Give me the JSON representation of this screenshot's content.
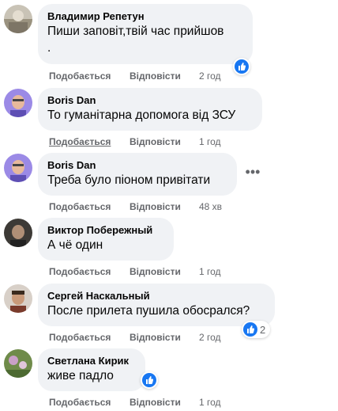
{
  "colors": {
    "accent": "#1877f2",
    "bubble": "#f0f2f5",
    "meta": "#65676b"
  },
  "labels": {
    "like": "Подобається",
    "reply": "Відповісти"
  },
  "comments": [
    {
      "author": "Владимир Репетун",
      "lines": [
        "Пиши заповіт,твій час прийшов",
        "."
      ],
      "time": "2 год",
      "reaction": {
        "icon": "like-icon",
        "count": ""
      }
    },
    {
      "author": "Boris Dan",
      "lines": [
        "То гуманітарна допомога від ЗСУ"
      ],
      "time": "1 год"
    },
    {
      "author": "Boris Dan",
      "lines": [
        "Треба було піоном привітати"
      ],
      "time": "48 хв",
      "more_icon": "more-dots-icon"
    },
    {
      "author": "Виктор Побережный",
      "lines": [
        "А чё один"
      ],
      "time": "1 год"
    },
    {
      "author": "Сергей Наскальный",
      "lines": [
        "После прилета пушила обосрался?"
      ],
      "time": "2 год",
      "reaction": {
        "icon": "like-icon",
        "count": "2"
      }
    },
    {
      "author": "Светлана Кирик",
      "lines": [
        "живе падло"
      ],
      "time": "1 год",
      "reaction": {
        "icon": "like-icon",
        "count": ""
      }
    }
  ]
}
